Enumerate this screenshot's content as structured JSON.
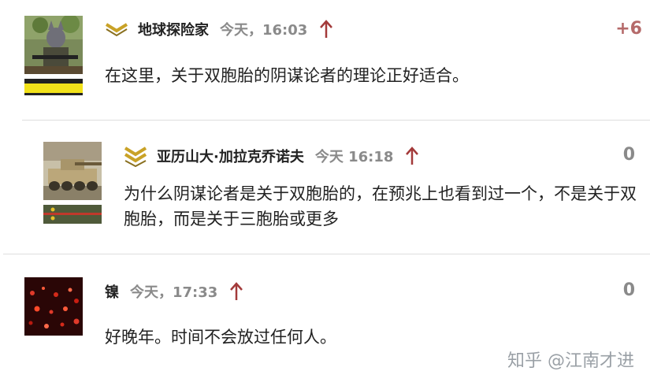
{
  "comments": [
    {
      "author": "地球探险家",
      "time": "今天，16:03",
      "score": "+6",
      "text": "在这里，关于双胞胎的阴谋论者的理论正好适合。"
    },
    {
      "author": "亚历山大·加拉克乔诺夫",
      "time": "今天 16:18",
      "score": "0",
      "text": "为什么阴谋论者是关于双胞胎的，在预兆上也看到过一个，不是关于双胞胎，而是关于三胞胎或更多"
    },
    {
      "author": "镍",
      "time": "今天，17:33",
      "score": "0",
      "text": "好晚年。时间不会放过任何人。"
    }
  ],
  "watermark": "知乎 @江南才进",
  "colors": {
    "vote_arrow": "#a33a3a",
    "rank_gold": "#c9a227",
    "score_positive": "#b56a6a"
  }
}
